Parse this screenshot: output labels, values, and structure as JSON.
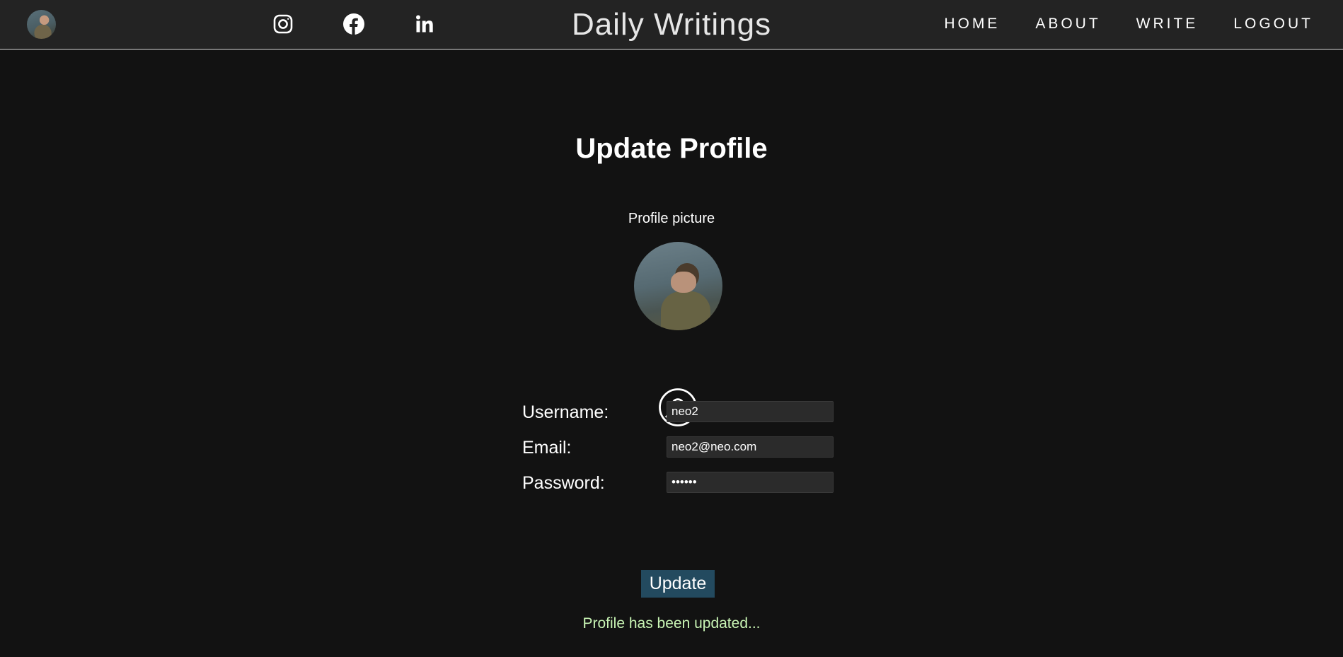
{
  "navbar": {
    "brand": "Daily Writings",
    "links": [
      {
        "label": "HOME"
      },
      {
        "label": "ABOUT"
      },
      {
        "label": "WRITE"
      },
      {
        "label": "LOGOUT"
      }
    ],
    "social_icons": [
      "instagram-icon",
      "facebook-icon",
      "linkedin-icon"
    ]
  },
  "page": {
    "title": "Update Profile",
    "profile_picture_label": "Profile picture"
  },
  "form": {
    "username_label": "Username:",
    "username_value": "neo2",
    "email_label": "Email:",
    "email_value": "neo2@neo.com",
    "password_label": "Password:",
    "password_value": "123456",
    "submit_label": "Update"
  },
  "status": {
    "message": "Profile has been updated...",
    "color": "#c9f5b5"
  },
  "colors": {
    "navbar_bg": "#232323",
    "page_bg": "#121212",
    "button_bg": "#234a5f"
  }
}
